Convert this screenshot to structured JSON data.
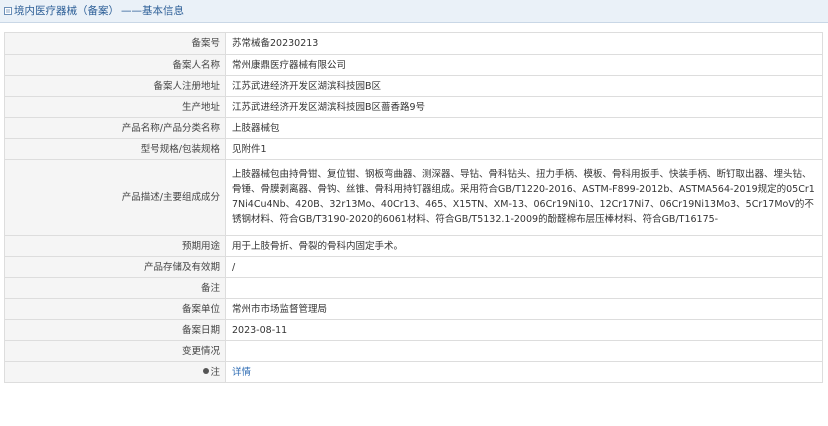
{
  "header": {
    "title": "境内医疗器械（备案）",
    "subtitle": "——基本信息"
  },
  "rows": [
    {
      "label": "备案号",
      "value": "苏常械备20230213"
    },
    {
      "label": "备案人名称",
      "value": "常州康鼎医疗器械有限公司"
    },
    {
      "label": "备案人注册地址",
      "value": "江苏武进经济开发区湖滨科技园B区"
    },
    {
      "label": "生产地址",
      "value": "江苏武进经济开发区湖滨科技园B区蔷香路9号"
    },
    {
      "label": "产品名称/产品分类名称",
      "value": "上肢器械包"
    },
    {
      "label": "型号规格/包装规格",
      "value": "见附件1"
    },
    {
      "label": "产品描述/主要组成成分",
      "value": "上肢器械包由持骨钳、复位钳、钢板弯曲器、测深器、导钻、骨科钻头、扭力手柄、模板、骨科用扳手、快装手柄、断钉取出器、埋头钻、骨锤、骨膜剥离器、骨钩、丝锥、骨科用持钉器组成。采用符合GB/T1220-2016、ASTM-F899-2012b、ASTMA564-2019规定的05Cr17Ni4Cu4Nb、420B、32r13Mo、40Cr13、465、X15TN、XM-13、06Cr19Ni10、12Cr17Ni7、06Cr19Ni13Mo3、5Cr17MoV的不锈钢材料、符合GB/T3190-2020的6061材料、符合GB/T5132.1-2009的酚醛棉布层压棒材料、符合GB/T16175-"
    },
    {
      "label": "预期用途",
      "value": "用于上肢骨折、骨裂的骨科内固定手术。"
    },
    {
      "label": "产品存储及有效期",
      "value": "/"
    },
    {
      "label": "备注",
      "value": ""
    },
    {
      "label": "备案单位",
      "value": "常州市市场监督管理局"
    },
    {
      "label": "备案日期",
      "value": "2023-08-11"
    },
    {
      "label": "变更情况",
      "value": ""
    },
    {
      "label": "注",
      "value": "详情"
    }
  ],
  "colors": {
    "header_bg": "#eaf1f8",
    "header_text": "#2d5f97",
    "label_bg": "#f5f5f5",
    "border": "#dddddd",
    "link": "#2d6bb3"
  },
  "icons": {
    "header": "doc-icon",
    "note": "pin-icon"
  }
}
